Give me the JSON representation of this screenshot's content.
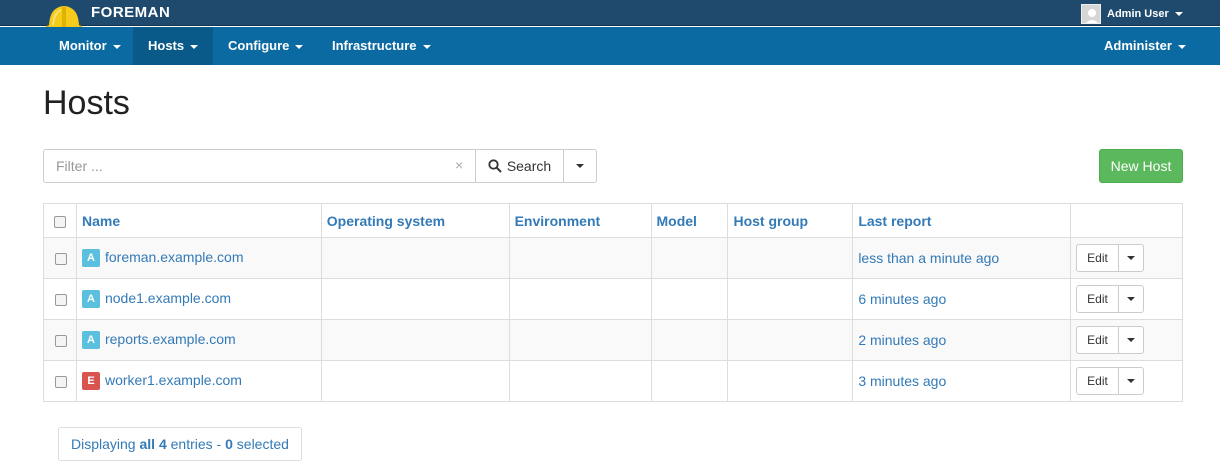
{
  "brand": {
    "name": "FOREMAN",
    "logo_icon": "hardhat-icon"
  },
  "user": {
    "name": "Admin User"
  },
  "nav": {
    "items": [
      {
        "label": "Monitor"
      },
      {
        "label": "Hosts"
      },
      {
        "label": "Configure"
      },
      {
        "label": "Infrastructure"
      }
    ],
    "right": {
      "label": "Administer"
    }
  },
  "page": {
    "title": "Hosts"
  },
  "search": {
    "placeholder": "Filter ...",
    "clear": "×",
    "button_label": "Search"
  },
  "actions": {
    "new_host": "New Host"
  },
  "table": {
    "headers": [
      "Name",
      "Operating system",
      "Environment",
      "Model",
      "Host group",
      "Last report"
    ],
    "rows": [
      {
        "status": "A",
        "name": "foreman.example.com",
        "os": "",
        "environment": "",
        "model": "",
        "hostgroup": "",
        "last_report": "less than a minute ago",
        "edit": "Edit"
      },
      {
        "status": "A",
        "name": "node1.example.com",
        "os": "",
        "environment": "",
        "model": "",
        "hostgroup": "",
        "last_report": "6 minutes ago",
        "edit": "Edit"
      },
      {
        "status": "A",
        "name": "reports.example.com",
        "os": "",
        "environment": "",
        "model": "",
        "hostgroup": "",
        "last_report": "2 minutes ago",
        "edit": "Edit"
      },
      {
        "status": "E",
        "name": "worker1.example.com",
        "os": "",
        "environment": "",
        "model": "",
        "hostgroup": "",
        "last_report": "3 minutes ago",
        "edit": "Edit"
      }
    ]
  },
  "footer": {
    "prefix": "Displaying ",
    "all": "all 4",
    "middle": " entries - ",
    "selected_count": "0",
    "suffix": " selected"
  },
  "colors": {
    "topbar": "#1f4a6e",
    "navbar": "#0a6aa1",
    "nav_active": "#095a89",
    "link": "#337ab7",
    "success": "#5cb85c",
    "status_a": "#5bc0de",
    "status_e": "#d9534f"
  }
}
